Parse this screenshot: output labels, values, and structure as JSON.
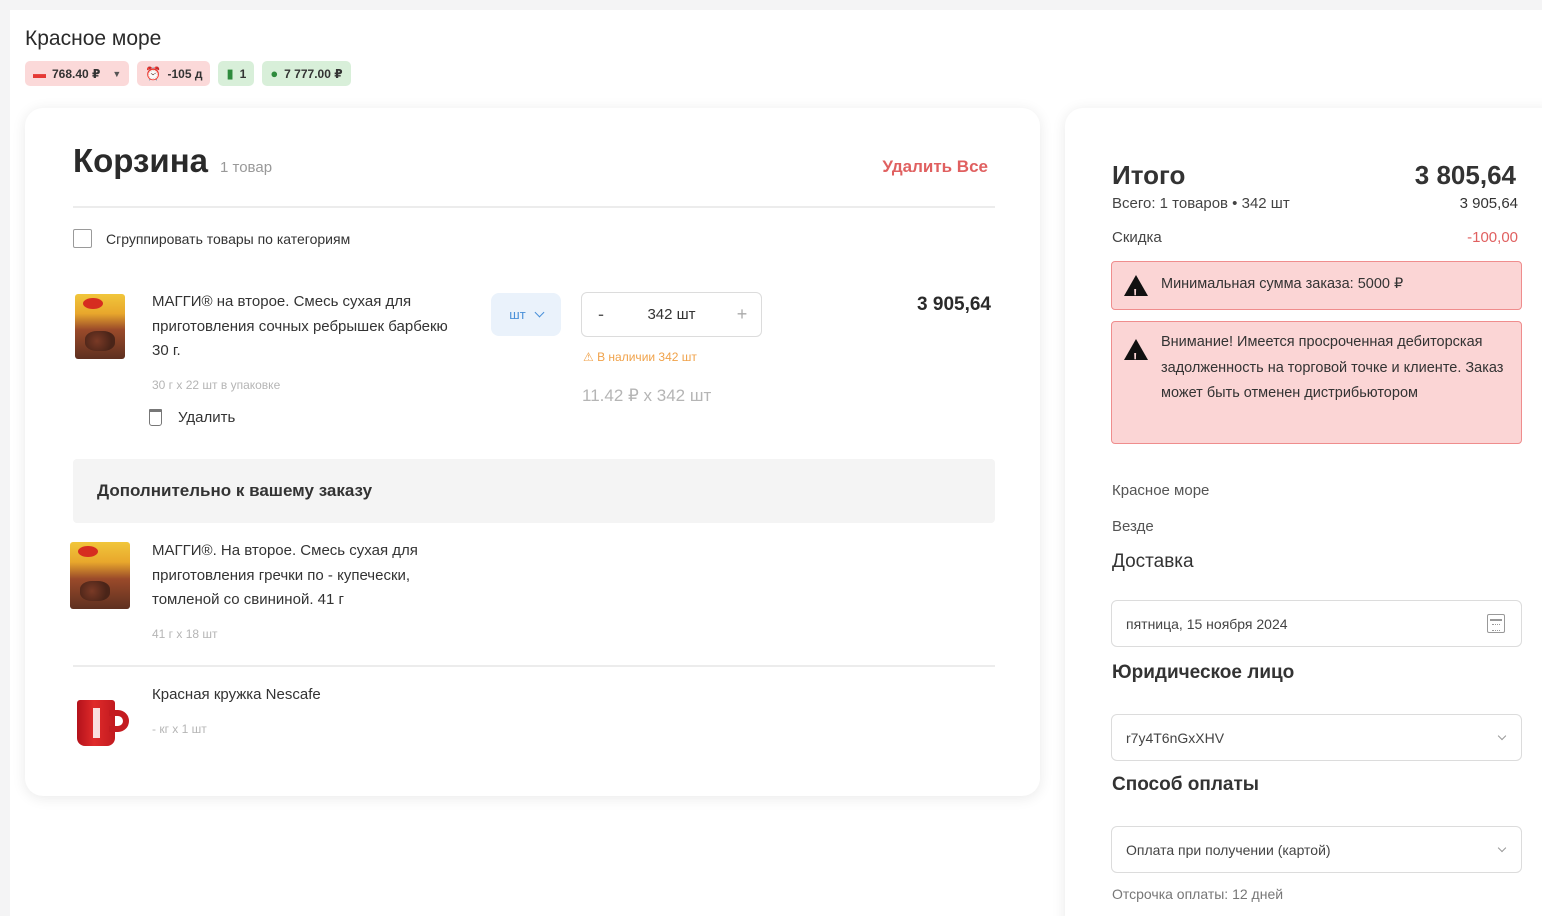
{
  "store": {
    "name": "Красное море"
  },
  "chips": [
    {
      "icon": "wallet-icon",
      "value": "768.40 ₽",
      "tone": "red",
      "has_dropdown": true
    },
    {
      "icon": "alarm-icon",
      "value": "-105 д",
      "tone": "red"
    },
    {
      "icon": "document-icon",
      "value": "1",
      "tone": "green"
    },
    {
      "icon": "money-icon",
      "value": "7 777.00 ₽",
      "tone": "green"
    }
  ],
  "cart": {
    "title": "Корзина",
    "count": "1 товар",
    "delete_all": "Удалить Все",
    "group_by_category": "Сгруппировать товары по категориям",
    "group_by_category_checked": false,
    "item": {
      "name": "МАГГИ® на второе. Смесь сухая для приготовления сочных ребрышек барбекю 30 г.",
      "pack": "30 г х 22 шт в упаковке",
      "delete": "Удалить",
      "unit": "шт",
      "qty_minus": "-",
      "qty": "342 шт",
      "qty_plus": "+",
      "stock": "⚠ В наличии 342 шт",
      "unit_price": "11.42 ₽ x 342 шт",
      "total": "3 905,64"
    },
    "extra_title": "Дополнительно к вашему заказу",
    "extras": [
      {
        "name": "МАГГИ®. На второе. Смесь сухая для приготовления гречки по - купечески, томленой со свининой. 41 г",
        "pack": "41 г х 18 шт"
      },
      {
        "name": "Красная кружка Nescafe",
        "pack": "- кг х 1 шт"
      }
    ]
  },
  "summary": {
    "title": "Итого",
    "total": "3 805,64",
    "subtotal_label": "Всего: 1 товаров • 342 шт",
    "subtotal_value": "3 905,64",
    "discount_label": "Скидка",
    "discount_value": "-100,00",
    "alert_min": "Минимальная сумма заказа: 5000 ₽",
    "alert_debt": "Внимание! Имеется просроченная дебиторская задолженность на торговой точке и клиенте. Заказ может быть отменен дистрибьютором",
    "store": "Красное море",
    "zone": "Везде",
    "delivery_title": "Доставка",
    "delivery_date": "пятница, 15 ноября 2024",
    "legal_title": "Юридическое лицо",
    "legal_value": "r7y4T6nGxXHV",
    "payment_title": "Способ оплаты",
    "payment_value": "Оплата при получении (картой)",
    "deferral": "Отсрочка оплаты: 12 дней"
  },
  "colors": {
    "accent_red": "#e06060",
    "chip_red_bg": "#fbd9d9",
    "chip_green_bg": "#d8efd9",
    "alert_bg": "#fbd5d5",
    "unit_blue": "#4a90d9",
    "stock_orange": "#f0a24a"
  }
}
